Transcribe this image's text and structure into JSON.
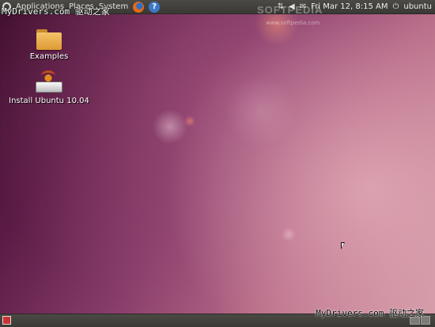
{
  "top_panel": {
    "menus": [
      "Applications",
      "Places",
      "System"
    ],
    "clock": "Fri Mar 12,  8:15 AM",
    "user": "ubuntu",
    "icons": [
      "ubuntu-logo-icon",
      "firefox-icon",
      "help-icon",
      "network-icon",
      "volume-icon",
      "mail-icon",
      "power-icon"
    ]
  },
  "watermarks": {
    "top_left": "MyDrivers.com 驱动之家",
    "center": "SOFTPEDIA",
    "center_small": "www.softpedia.com",
    "bottom_right": "MyDrivers.com 驱动之家"
  },
  "desktop": {
    "items": [
      {
        "label": "Examples",
        "icon": "folder-icon"
      },
      {
        "label": "Install Ubuntu 10.04",
        "icon": "installer-icon"
      }
    ]
  },
  "bottom_panel": {
    "icons": [
      "show-desktop-icon",
      "workspace-switcher-icon"
    ]
  },
  "colors": {
    "panel": "#3a3935",
    "wallpaper_dark": "#3d0d2c",
    "wallpaper_light": "#d39aa6"
  }
}
